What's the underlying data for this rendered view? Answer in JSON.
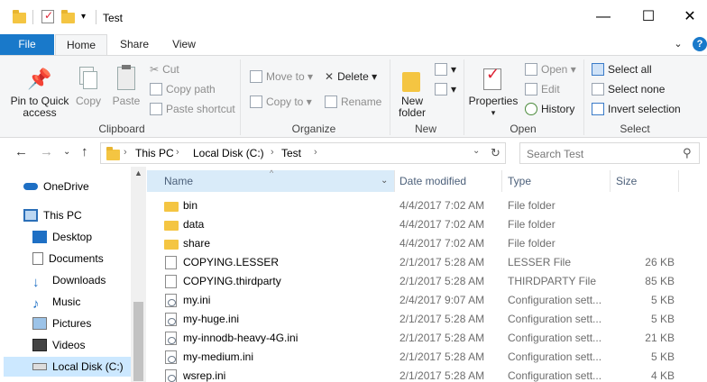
{
  "window": {
    "title": "Test"
  },
  "tabs": {
    "file": "File",
    "home": "Home",
    "share": "Share",
    "view": "View"
  },
  "ribbon": {
    "clipboard": {
      "label": "Clipboard",
      "pin": "Pin to Quick access",
      "copy": "Copy",
      "paste": "Paste",
      "cut": "Cut",
      "copy_path": "Copy path",
      "paste_shortcut": "Paste shortcut"
    },
    "organize": {
      "label": "Organize",
      "move_to": "Move to",
      "copy_to": "Copy to",
      "delete": "Delete",
      "rename": "Rename"
    },
    "new": {
      "label": "New",
      "new_folder": "New folder"
    },
    "open": {
      "label": "Open",
      "properties": "Properties",
      "open": "Open",
      "edit": "Edit",
      "history": "History"
    },
    "select": {
      "label": "Select",
      "select_all": "Select all",
      "select_none": "Select none",
      "invert": "Invert selection"
    }
  },
  "address": {
    "crumbs": [
      "This PC",
      "Local Disk (C:)",
      "Test"
    ],
    "search_placeholder": "Search Test"
  },
  "nav": [
    {
      "label": "OneDrive"
    },
    {
      "label": "This PC"
    },
    {
      "label": "Desktop"
    },
    {
      "label": "Documents"
    },
    {
      "label": "Downloads"
    },
    {
      "label": "Music"
    },
    {
      "label": "Pictures"
    },
    {
      "label": "Videos"
    },
    {
      "label": "Local Disk (C:)"
    }
  ],
  "columns": {
    "name": "Name",
    "date": "Date modified",
    "type": "Type",
    "size": "Size"
  },
  "files": [
    {
      "name": "bin",
      "date": "4/4/2017 7:02 AM",
      "type": "File folder",
      "size": "",
      "icon": "folder"
    },
    {
      "name": "data",
      "date": "4/4/2017 7:02 AM",
      "type": "File folder",
      "size": "",
      "icon": "folder"
    },
    {
      "name": "share",
      "date": "4/4/2017 7:02 AM",
      "type": "File folder",
      "size": "",
      "icon": "folder"
    },
    {
      "name": "COPYING.LESSER",
      "date": "2/1/2017 5:28 AM",
      "type": "LESSER File",
      "size": "26 KB",
      "icon": "doc"
    },
    {
      "name": "COPYING.thirdparty",
      "date": "2/1/2017 5:28 AM",
      "type": "THIRDPARTY File",
      "size": "85 KB",
      "icon": "doc"
    },
    {
      "name": "my.ini",
      "date": "2/4/2017 9:07 AM",
      "type": "Configuration sett...",
      "size": "5 KB",
      "icon": "ini"
    },
    {
      "name": "my-huge.ini",
      "date": "2/1/2017 5:28 AM",
      "type": "Configuration sett...",
      "size": "5 KB",
      "icon": "ini"
    },
    {
      "name": "my-innodb-heavy-4G.ini",
      "date": "2/1/2017 5:28 AM",
      "type": "Configuration sett...",
      "size": "21 KB",
      "icon": "ini"
    },
    {
      "name": "my-medium.ini",
      "date": "2/1/2017 5:28 AM",
      "type": "Configuration sett...",
      "size": "5 KB",
      "icon": "ini"
    },
    {
      "name": "wsrep.ini",
      "date": "2/1/2017 5:28 AM",
      "type": "Configuration sett...",
      "size": "4 KB",
      "icon": "ini"
    }
  ]
}
